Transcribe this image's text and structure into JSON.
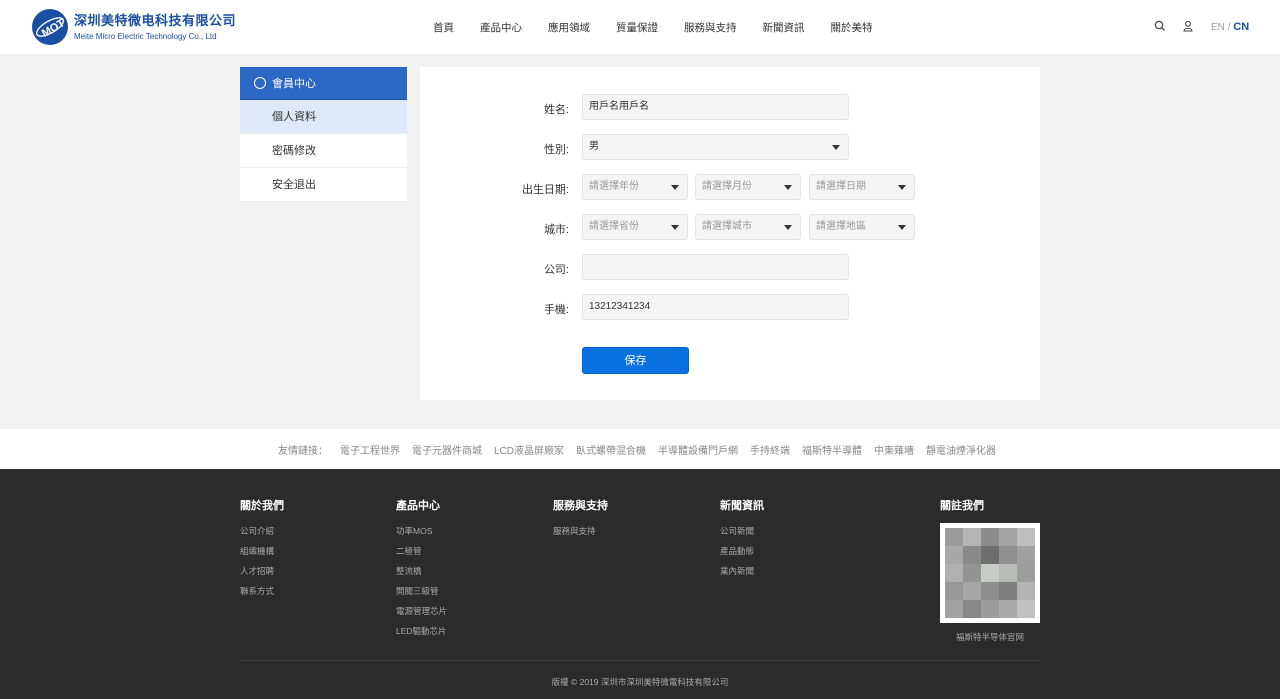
{
  "header": {
    "logo_cn": "深圳美特微电科技有限公司",
    "logo_en": "Meite Micro Electric Technology Co., Ltd",
    "nav": [
      "首頁",
      "產品中心",
      "應用領域",
      "質量保證",
      "服務與支持",
      "新聞資訊",
      "關於美特"
    ],
    "lang_en": "EN",
    "lang_sep": "/",
    "lang_cn": "CN",
    "icons": [
      "search-icon",
      "user-icon"
    ]
  },
  "sidebar": {
    "title": "會員中心",
    "items": [
      {
        "label": "個人資料",
        "active": true
      },
      {
        "label": "密碼修改",
        "active": false
      },
      {
        "label": "安全退出",
        "active": false
      }
    ]
  },
  "form": {
    "name_label": "姓名:",
    "name_value": "用戶名用戶名",
    "gender_label": "性別:",
    "gender_value": "男",
    "birth_label": "出生日期:",
    "birth_year": "請選擇年份",
    "birth_month": "請選擇月份",
    "birth_day": "請選擇日期",
    "city_label": "城市:",
    "province": "請選擇省份",
    "city": "請選擇城市",
    "district": "請選擇地區",
    "company_label": "公司:",
    "company_value": "",
    "phone_label": "手機:",
    "phone_value": "13212341234",
    "save_label": "保存"
  },
  "friend_links": {
    "label": "友情鏈接：",
    "items": [
      "電子工程世界",
      "電子元器件商城",
      "LCD液晶屏廠家",
      "臥式螺帶混合機",
      "半導體設備門戶網",
      "手持終端",
      "福斯特半導體",
      "中東薙墻",
      "靜電油煙淨化器"
    ]
  },
  "footer": {
    "columns": [
      {
        "title": "關於我們",
        "links": [
          "公司介紹",
          "組織機構",
          "人才招聘",
          "聯系方式"
        ]
      },
      {
        "title": "產品中心",
        "links": [
          "功率MOS",
          "二極管",
          "整流橋",
          "開關三級管",
          "電源管理芯片",
          "LED驅動芯片"
        ]
      },
      {
        "title": "服務與支持",
        "links": [
          "服務與支持"
        ]
      },
      {
        "title": "新聞資訊",
        "links": [
          "公司新聞",
          "產品動態",
          "業內新聞"
        ]
      }
    ],
    "follow_title": "關註我們",
    "qr_caption": "福斯特半导体官网",
    "copyright": "版權 © 2019 深圳市深圳美特微電科技有限公司"
  }
}
